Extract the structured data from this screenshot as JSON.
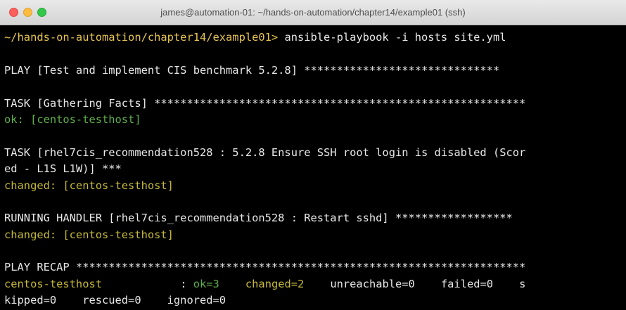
{
  "window": {
    "title": "james@automation-01: ~/hands-on-automation/chapter14/example01 (ssh)"
  },
  "terminal": {
    "prompt": "~/hands-on-automation/chapter14/example01>",
    "command": " ansible-playbook -i hosts site.yml",
    "play_header": "PLAY [Test and implement CIS benchmark 5.2.8] ******************************",
    "task1_header": "TASK [Gathering Facts] *********************************************************",
    "task1_result": "ok: [centos-testhost]",
    "task2_header_line1": "TASK [rhel7cis_recommendation528 : 5.2.8 Ensure SSH root login is disabled (Scor",
    "task2_header_line2": "ed - L1S L1W)] ***",
    "task2_result": "changed: [centos-testhost]",
    "handler_header": "RUNNING HANDLER [rhel7cis_recommendation528 : Restart sshd] ******************",
    "handler_result": "changed: [centos-testhost]",
    "recap_header": "PLAY RECAP *********************************************************************",
    "recap": {
      "host": "centos-testhost            ",
      "sep": ": ",
      "ok": "ok=3",
      "gap1": "    ",
      "changed": "changed=2",
      "rest_line1": "    unreachable=0    failed=0    s",
      "rest_line2": "kipped=0    rescued=0    ignored=0"
    }
  },
  "colors": {
    "background": "#000000",
    "prompt": "#e8c552",
    "ok": "#5fb04a",
    "changed": "#c6b93a",
    "text": "#e8e8e8"
  }
}
